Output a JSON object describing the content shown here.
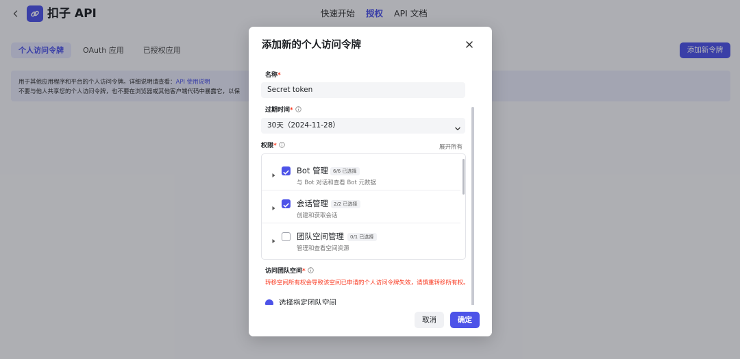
{
  "header": {
    "back_icon": "chevron-left-icon",
    "logo_icon": "link-logo-icon",
    "brand": "扣子 API",
    "nav": [
      {
        "label": "快速开始",
        "active": false
      },
      {
        "label": "授权",
        "active": true
      },
      {
        "label": "API 文档",
        "active": false
      }
    ]
  },
  "tabs": [
    {
      "label": "个人访问令牌",
      "active": true
    },
    {
      "label": "OAuth 应用",
      "active": false
    },
    {
      "label": "已授权应用",
      "active": false
    }
  ],
  "add_token_button": "添加新令牌",
  "notice": {
    "line1": "用于其他应用程序和平台的个人访问令牌。详细说明请查看：",
    "link": "API 使用说明",
    "line2": "不要与他人共享您的个人访问令牌，也不要在浏览器或其他客户端代码中暴露它，以保"
  },
  "modal": {
    "title": "添加新的个人访问令牌",
    "close_icon": "close-icon",
    "name_label": "名称",
    "name_value": "Secret token",
    "expiry_label": "过期时间",
    "expiry_value": "30天（2024-11-28）",
    "permissions_label": "权限",
    "expand_all": "展开所有",
    "permissions": [
      {
        "name": "Bot 管理",
        "count": "6/6 已选择",
        "desc": "与 Bot 对话和查看 Bot 元数据",
        "checked": true
      },
      {
        "name": "会话管理",
        "count": "2/2 已选择",
        "desc": "创建和获取会话",
        "checked": true
      },
      {
        "name": "团队空间管理",
        "count": "0/1 已选择",
        "desc": "管理和查看空间资源",
        "checked": false
      }
    ],
    "space_label": "访问团队空间",
    "space_warning": "转移空间所有权会导致该空间已申请的个人访问令牌失效，请慎重转移所有权。",
    "space_option": "选择指定团队空间",
    "cancel": "取消",
    "confirm": "确定"
  },
  "colors": {
    "accent": "#4d53e8",
    "required": "#f93920"
  }
}
